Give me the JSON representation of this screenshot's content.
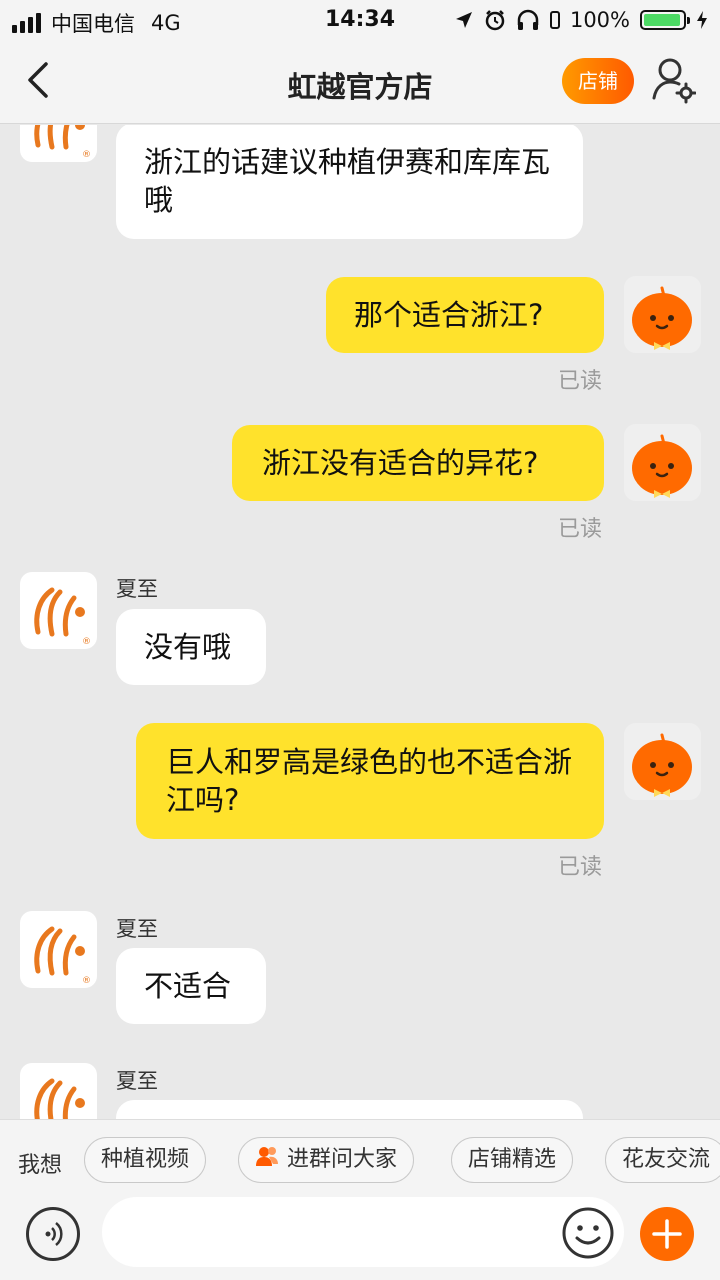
{
  "status_bar": {
    "carrier": "中国电信",
    "network": "4G",
    "time": "14:34",
    "battery": "100%",
    "battery_color": "#4cd964"
  },
  "nav": {
    "back_icon": "chevron-left-icon",
    "title": "虹越官方店",
    "shop_button": "店铺",
    "user_settings_icon": "user-gear-icon"
  },
  "messages": [
    {
      "side": "left",
      "sender": "",
      "text": "浙江的话建议种植伊赛和库库瓦哦"
    },
    {
      "side": "right",
      "text": "那个适合浙江?",
      "status": "已读"
    },
    {
      "side": "right",
      "text": "浙江没有适合的异花?",
      "status": "已读"
    },
    {
      "side": "left",
      "sender": "夏至",
      "text": "没有哦"
    },
    {
      "side": "right",
      "text": "巨人和罗高是绿色的也不适合浙江吗?",
      "status": "已读"
    },
    {
      "side": "left",
      "sender": "夏至",
      "text": "不适合"
    },
    {
      "side": "left",
      "sender": "夏至",
      "text": ""
    }
  ],
  "quick_bar": {
    "label": "我想",
    "chips": [
      "种植视频",
      "进群问大家",
      "店铺精选",
      "花友交流"
    ]
  },
  "input_bar": {
    "voice_icon": "voice-icon",
    "emoji_icon": "emoji-icon",
    "plus_icon": "plus-icon",
    "accent": "#ff6a00"
  }
}
